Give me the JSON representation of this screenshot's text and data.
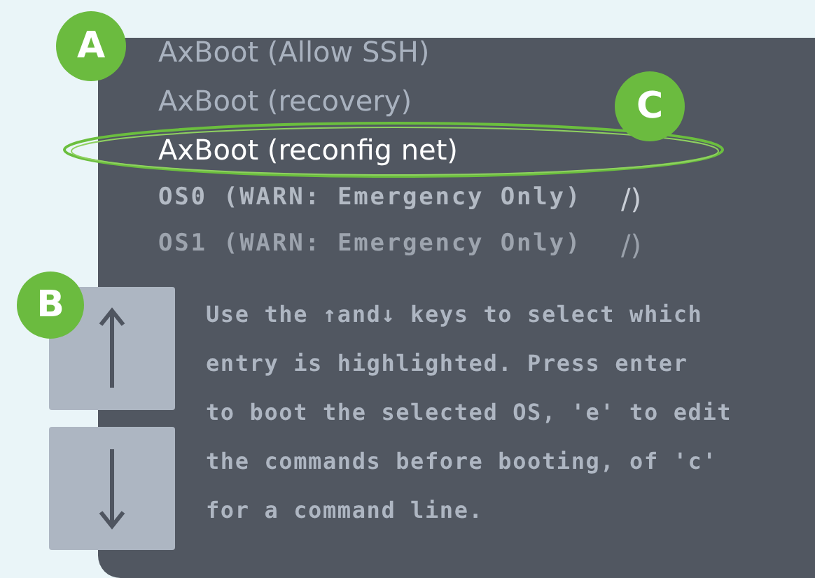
{
  "menu": {
    "entries": [
      {
        "kind": "entry",
        "label": "AxBoot (Allow SSH)",
        "selected": false
      },
      {
        "kind": "entry",
        "label": "AxBoot (recovery)",
        "selected": false
      },
      {
        "kind": "entry",
        "label": "AxBoot (reconfig net)",
        "selected": true
      },
      {
        "kind": "os",
        "label": "OS0 (WARN: Emergency Only)",
        "suffix": "/)",
        "faded": false
      },
      {
        "kind": "os",
        "label": "OS1 (WARN: Emergency Only)",
        "suffix": "/)",
        "faded": true
      }
    ]
  },
  "help_text": "Use the ↑and↓ keys to select which\nentry is highlighted. Press enter\nto boot the selected OS, 'e' to edit\nthe commands before booting, of 'c'\nfor a command line.",
  "keys": [
    {
      "kind": "up"
    },
    {
      "kind": "down"
    }
  ],
  "callouts": [
    {
      "label": "A",
      "kind": "menu"
    },
    {
      "label": "B",
      "kind": "keys"
    },
    {
      "label": "C",
      "kind": "selected"
    }
  ]
}
